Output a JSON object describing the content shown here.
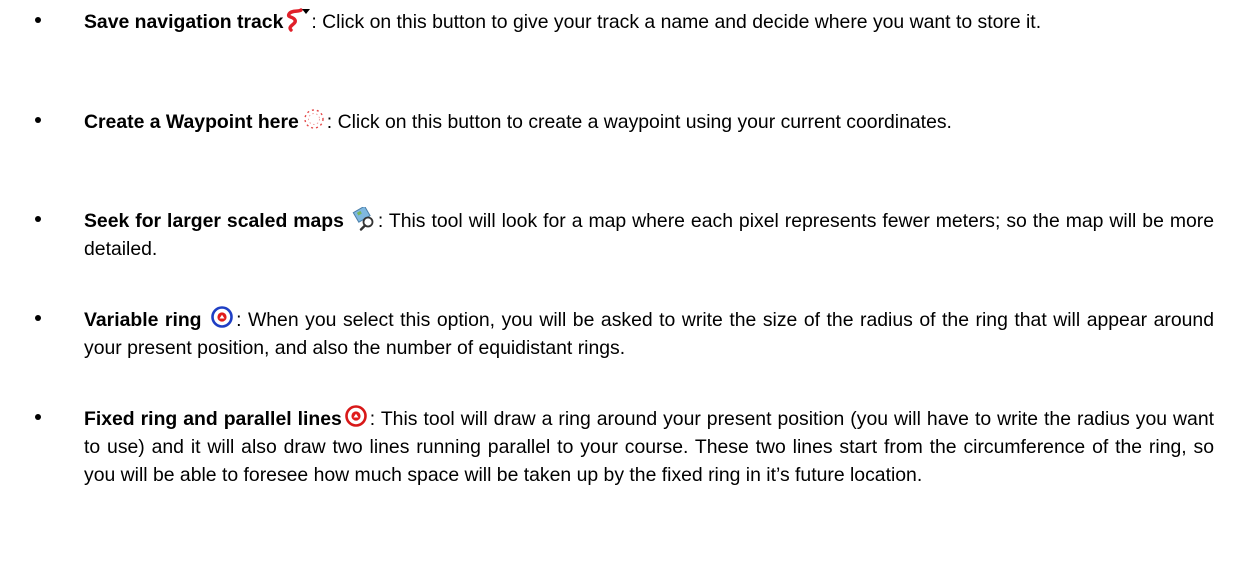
{
  "items": [
    {
      "term": "Save navigation track",
      "icon": "save-track-icon",
      "description": ": Click on this button to give your track a name and decide where you want to store it."
    },
    {
      "term": "Create a Waypoint here",
      "icon": "waypoint-icon",
      "description": ": Click on this button to create a waypoint using your current coordinates."
    },
    {
      "term": "Seek for larger scaled maps",
      "icon": "map-search-icon",
      "description": ": This tool will look for a map where each pixel represents fewer meters; so the map will be more detailed."
    },
    {
      "term": "Variable ring",
      "icon": "variable-ring-icon",
      "description": ": When you select this option, you will be asked to write the size of the radius of the ring that will appear around your present position, and also the number of equidistant rings."
    },
    {
      "term": "Fixed ring and parallel lines",
      "icon": "fixed-ring-icon",
      "description": ": This tool will draw a ring around your present position (you will have to write the radius you want to use) and it will also draw two lines running parallel to your course. These two lines start from the circumference of the ring, so you will be able to foresee how much space will be taken up by the fixed ring in it’s future location."
    }
  ]
}
